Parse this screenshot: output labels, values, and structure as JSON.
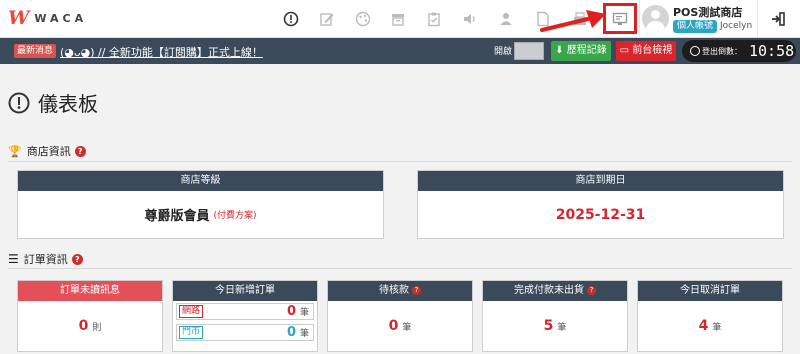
{
  "brand": {
    "logo_mark": "W",
    "name": "WACA"
  },
  "header": {
    "store_name": "POS測試商店",
    "account_badge": "個人帳號",
    "username": "Jocelyn"
  },
  "announce": {
    "badge": "最新消息",
    "text": "(◕ᴗ◕) // 全新功能【訂閱購】正式上線！",
    "open_label": "開啟",
    "history_button": "歷程記錄",
    "storefront_button": "前台檢視",
    "logout_label": "登出倒數：",
    "logout_time": "10:58"
  },
  "page": {
    "title": "儀表板"
  },
  "store_info": {
    "heading": "商店資訊",
    "level": {
      "header": "商店等級",
      "value": "尊爵版會員",
      "link": "(付費方案)"
    },
    "expiry": {
      "header": "商店到期日",
      "value": "2025-12-31"
    }
  },
  "order_info": {
    "heading": "訂單資訊",
    "unread": {
      "header": "訂單未讀訊息",
      "value": "0",
      "unit": "則"
    },
    "today_new": {
      "header": "今日新增訂單",
      "net_label": "網路",
      "net_value": "0",
      "net_unit": "筆",
      "shop_label": "門市",
      "shop_value": "0",
      "shop_unit": "筆"
    },
    "pending_payment": {
      "header": "待核款",
      "value": "0",
      "unit": "筆"
    },
    "paid_not_shipped": {
      "header": "完成付款未出貨",
      "value": "5",
      "unit": "筆"
    },
    "today_cancel": {
      "header": "今日取消訂單",
      "value": "4",
      "unit": "筆"
    }
  },
  "colors": {
    "brand_red": "#e84b3c",
    "nav_dark": "#3b4a5a",
    "accent_red": "#d7262e",
    "green": "#3aa64a",
    "cyan": "#2aa6c4"
  }
}
